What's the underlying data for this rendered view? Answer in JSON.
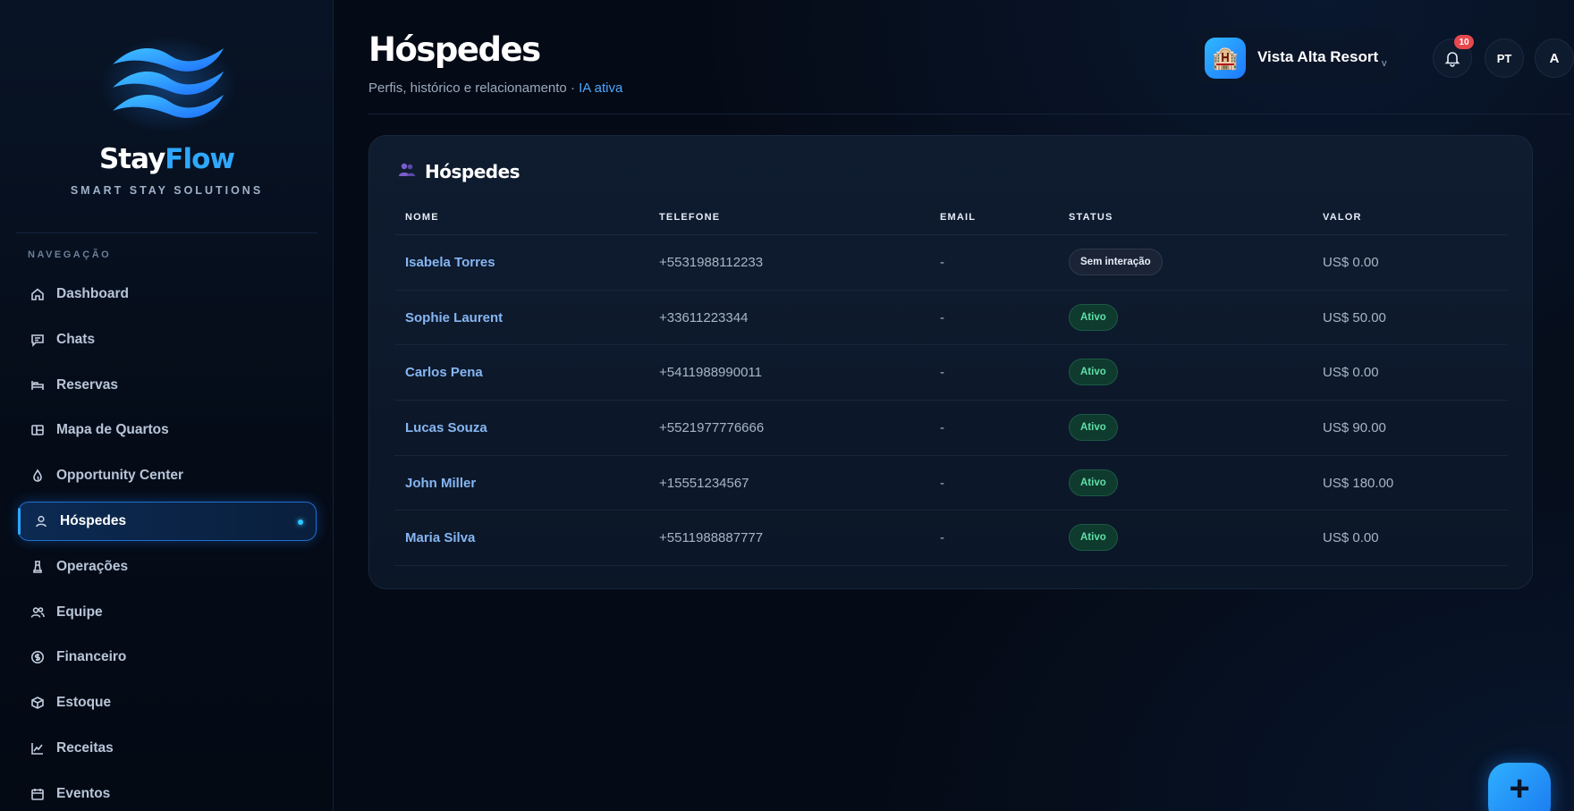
{
  "brand": {
    "name_part1": "Stay",
    "name_part2": "Flow",
    "tagline": "SMART STAY SOLUTIONS"
  },
  "sidebar": {
    "heading": "NAVEGAÇÃO",
    "items": [
      {
        "label": "Dashboard",
        "icon": "home-icon",
        "active": false
      },
      {
        "label": "Chats",
        "icon": "chat-icon",
        "active": false
      },
      {
        "label": "Reservas",
        "icon": "bed-icon",
        "active": false
      },
      {
        "label": "Mapa de Quartos",
        "icon": "layout-icon",
        "active": false
      },
      {
        "label": "Opportunity Center",
        "icon": "flame-icon",
        "active": false
      },
      {
        "label": "Hóspedes",
        "icon": "user-icon",
        "active": true
      },
      {
        "label": "Operações",
        "icon": "chess-icon",
        "active": false
      },
      {
        "label": "Equipe",
        "icon": "team-icon",
        "active": false
      },
      {
        "label": "Financeiro",
        "icon": "dollar-icon",
        "active": false
      },
      {
        "label": "Estoque",
        "icon": "box-icon",
        "active": false
      },
      {
        "label": "Receitas",
        "icon": "chart-line-icon",
        "active": false
      },
      {
        "label": "Eventos",
        "icon": "calendar-icon",
        "active": false
      }
    ]
  },
  "header": {
    "title": "Hóspedes",
    "subtitle": "Perfis, histórico e relacionamento · ",
    "subtitle_highlight": "IA ativa",
    "hotel_name": "Vista Alta Resort",
    "hotel_caret": "v",
    "notifications_count": "10",
    "language": "PT",
    "avatar_initial": "A"
  },
  "card": {
    "title": "Hóspedes",
    "columns": [
      "NOME",
      "TELEFONE",
      "EMAIL",
      "STATUS",
      "VALOR"
    ],
    "rows": [
      {
        "nome": "Isabela Torres",
        "telefone": "+5531988112233",
        "email": "-",
        "status": "Sem interação",
        "status_type": "sem",
        "valor": "US$ 0.00"
      },
      {
        "nome": "Sophie Laurent",
        "telefone": "+33611223344",
        "email": "-",
        "status": "Ativo",
        "status_type": "ativo",
        "valor": "US$ 50.00"
      },
      {
        "nome": "Carlos Pena",
        "telefone": "+5411988990011",
        "email": "-",
        "status": "Ativo",
        "status_type": "ativo",
        "valor": "US$ 0.00"
      },
      {
        "nome": "Lucas Souza",
        "telefone": "+5521977776666",
        "email": "-",
        "status": "Ativo",
        "status_type": "ativo",
        "valor": "US$ 90.00"
      },
      {
        "nome": "John Miller",
        "telefone": "+15551234567",
        "email": "-",
        "status": "Ativo",
        "status_type": "ativo",
        "valor": "US$ 180.00"
      },
      {
        "nome": "Maria Silva",
        "telefone": "+5511988887777",
        "email": "-",
        "status": "Ativo",
        "status_type": "ativo",
        "valor": "US$ 0.00"
      }
    ]
  },
  "fab": {
    "label": "+"
  },
  "colors": {
    "accent": "#2ea8ff",
    "active_status": "#5fe0a8",
    "badge": "#e5484d",
    "background": "#050b16"
  }
}
